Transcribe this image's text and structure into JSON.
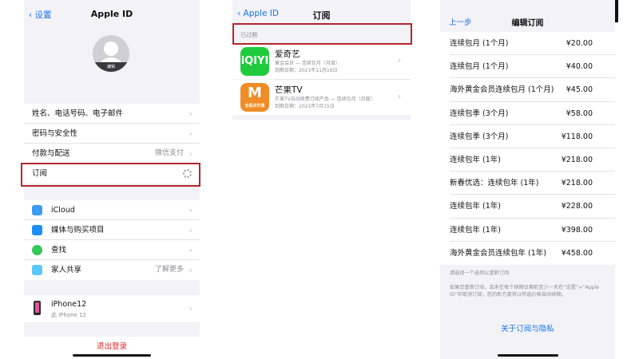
{
  "colors": {
    "accent_blue": "#1a73e8",
    "destructive_red": "#e0262b",
    "highlight_red": "#b3262d",
    "background_gray": "#f2f2f7"
  },
  "apple_id_screen": {
    "back_label": "设置",
    "title": "Apple ID",
    "avatar_label": "编辑",
    "account_group": [
      {
        "label": "姓名、电话号码、电子邮件",
        "detail": ""
      },
      {
        "label": "密码与安全性",
        "detail": ""
      },
      {
        "label": "付款与配送",
        "detail": "微信支付"
      },
      {
        "label": "订阅",
        "detail": ""
      }
    ],
    "services_group": [
      {
        "label": "iCloud",
        "detail": "",
        "icon": "cloud-icon",
        "icon_color": "#3b9cf3"
      },
      {
        "label": "媒体与购买项目",
        "detail": "",
        "icon": "app-store-icon",
        "icon_color": "#1c8ef9"
      },
      {
        "label": "查找",
        "detail": "",
        "icon": "find-my-icon",
        "icon_color": "#34c759"
      },
      {
        "label": "家人共享",
        "detail": "了解更多",
        "icon": "family-sharing-icon",
        "icon_color": "#5ac8fa"
      }
    ],
    "device": {
      "name": "iPhone12",
      "subtitle": "此 iPhone 12"
    },
    "sign_out_label": "退出登录"
  },
  "subscriptions_screen": {
    "back_label": "Apple ID",
    "title": "订阅",
    "section_header": "已过期",
    "items": [
      {
        "icon_text": "iQIYI",
        "name": "爱奇艺",
        "detail": "黄金会员 — 连续包月（月度）",
        "date": "到期日期：2021年11月16日"
      },
      {
        "icon_text": "M",
        "icon_subtext": "全民共芒果",
        "name": "芒果TV",
        "detail": "芒果TV自动续费订阅产品 — 连续包月（月度）",
        "date": "到期日期：2021年7月15日"
      }
    ]
  },
  "edit_subscription_screen": {
    "back_label": "上一步",
    "title": "编辑订阅",
    "options": [
      {
        "name": "连续包月 (1个月)",
        "price": "¥20.00"
      },
      {
        "name": "连续包月 (1个月)",
        "price": "¥40.00"
      },
      {
        "name": "海外黄金会员连续包月 (1个月)",
        "price": "¥45.00"
      },
      {
        "name": "连续包季 (3个月)",
        "price": "¥58.00"
      },
      {
        "name": "连续包季 (3个月)",
        "price": "¥118.00"
      },
      {
        "name": "连续包年 (1年)",
        "price": "¥218.00"
      },
      {
        "name": "新春优选：连续包年 (1年)",
        "price": "¥218.00"
      },
      {
        "name": "连续包年 (1年)",
        "price": "¥228.00"
      },
      {
        "name": "连续包年 (1年)",
        "price": "¥398.00"
      },
      {
        "name": "海外黄金会员连续包年 (1年)",
        "price": "¥458.00"
      }
    ],
    "footer_hint": "请选择一个选项以重新订阅",
    "footer_note": "如果您重新订阅，且未在每个续期日期前至少一天在“设置”>“Apple ID”中取消订阅，您的新方案将以所选价格自动续期。",
    "privacy_link": "关于订阅与隐私"
  }
}
